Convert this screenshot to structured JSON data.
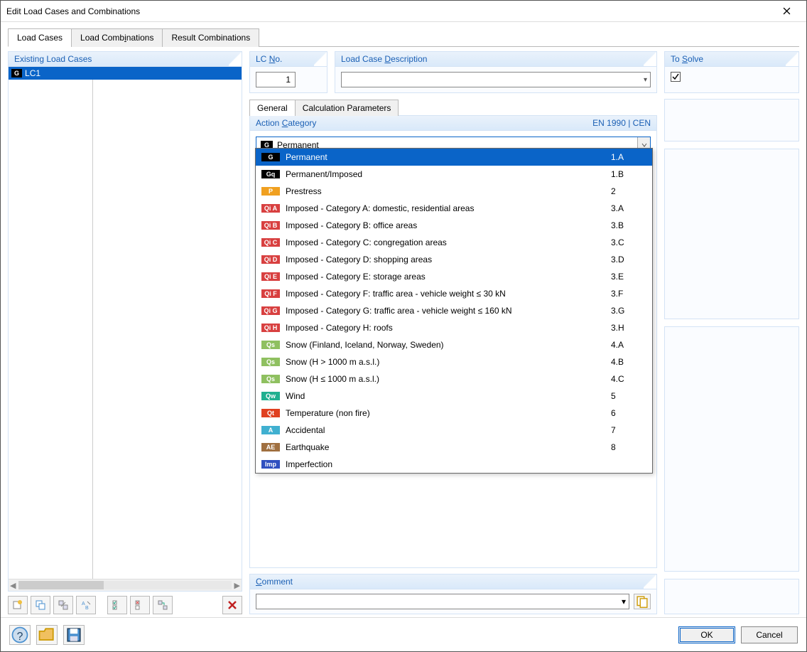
{
  "window": {
    "title": "Edit Load Cases and Combinations"
  },
  "tabs": {
    "load_cases": "Load Cases",
    "load_combinations": "Load Combinations",
    "result_combinations": "Result Combinations"
  },
  "existing": {
    "header": "Existing Load Cases",
    "rows": [
      {
        "badge": "G",
        "label": "LC1"
      }
    ]
  },
  "lc_no": {
    "header": "LC No.",
    "value": "1"
  },
  "description": {
    "header": "Load Case Description",
    "value": ""
  },
  "to_solve": {
    "header": "To Solve",
    "checked": true
  },
  "subtabs": {
    "general": "General",
    "calc": "Calculation Parameters"
  },
  "action_category": {
    "header": "Action Category",
    "standard": "EN 1990 | CEN",
    "selected": {
      "badge": "G",
      "label": "Permanent"
    },
    "options": [
      {
        "badge": "G",
        "badge_bg": "#000000",
        "label": "Permanent",
        "code": "1.A",
        "selected": true
      },
      {
        "badge": "Gq",
        "badge_bg": "#000000",
        "label": "Permanent/Imposed",
        "code": "1.B"
      },
      {
        "badge": "P",
        "badge_bg": "#f0a020",
        "label": "Prestress",
        "code": "2"
      },
      {
        "badge": "Qi A",
        "badge_bg": "#d84040",
        "label": "Imposed - Category A: domestic, residential areas",
        "code": "3.A"
      },
      {
        "badge": "Qi B",
        "badge_bg": "#d84040",
        "label": "Imposed - Category B: office areas",
        "code": "3.B"
      },
      {
        "badge": "Qi C",
        "badge_bg": "#d84040",
        "label": "Imposed - Category C: congregation areas",
        "code": "3.C"
      },
      {
        "badge": "Qi D",
        "badge_bg": "#d84040",
        "label": "Imposed - Category D: shopping areas",
        "code": "3.D"
      },
      {
        "badge": "Qi E",
        "badge_bg": "#d84040",
        "label": "Imposed - Category E: storage areas",
        "code": "3.E"
      },
      {
        "badge": "Qi F",
        "badge_bg": "#d84040",
        "label": "Imposed - Category F: traffic area - vehicle weight ≤ 30 kN",
        "code": "3.F"
      },
      {
        "badge": "Qi G",
        "badge_bg": "#d84040",
        "label": "Imposed - Category G: traffic area - vehicle weight ≤ 160 kN",
        "code": "3.G"
      },
      {
        "badge": "Qi H",
        "badge_bg": "#d84040",
        "label": "Imposed - Category H: roofs",
        "code": "3.H"
      },
      {
        "badge": "Qs",
        "badge_bg": "#8fc060",
        "label": "Snow (Finland, Iceland, Norway, Sweden)",
        "code": "4.A"
      },
      {
        "badge": "Qs",
        "badge_bg": "#8fc060",
        "label": "Snow (H > 1000 m a.s.l.)",
        "code": "4.B"
      },
      {
        "badge": "Qs",
        "badge_bg": "#8fc060",
        "label": "Snow (H ≤ 1000 m a.s.l.)",
        "code": "4.C"
      },
      {
        "badge": "Qw",
        "badge_bg": "#20b090",
        "label": "Wind",
        "code": "5"
      },
      {
        "badge": "Qt",
        "badge_bg": "#e04020",
        "label": "Temperature (non fire)",
        "code": "6"
      },
      {
        "badge": "A",
        "badge_bg": "#40b0d0",
        "label": "Accidental",
        "code": "7"
      },
      {
        "badge": "AE",
        "badge_bg": "#a07040",
        "label": "Earthquake",
        "code": "8"
      },
      {
        "badge": "Imp",
        "badge_bg": "#3050c0",
        "label": "Imperfection",
        "code": ""
      }
    ]
  },
  "comment": {
    "header": "Comment",
    "value": ""
  },
  "footer": {
    "ok": "OK",
    "cancel": "Cancel"
  }
}
